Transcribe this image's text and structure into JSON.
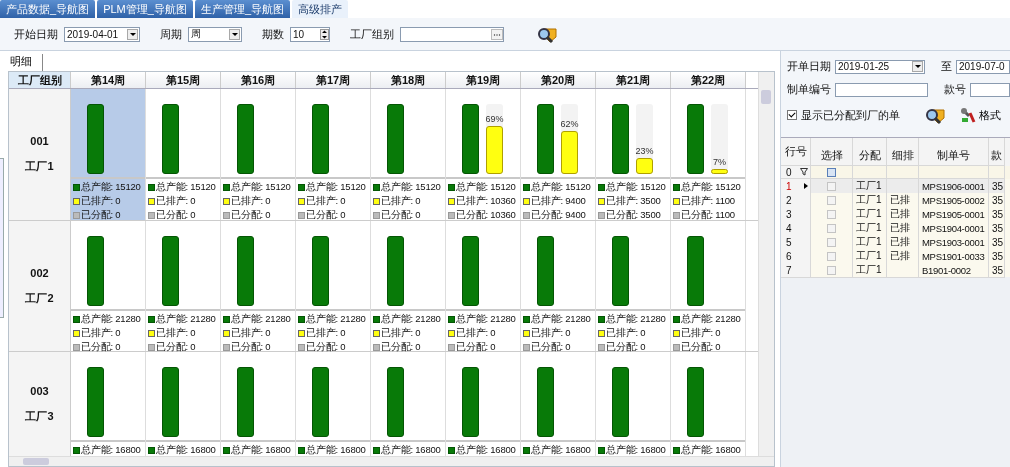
{
  "tabs": [
    {
      "label": "产品数据_导航图",
      "selected": false
    },
    {
      "label": "PLM管理_导航图",
      "selected": false
    },
    {
      "label": "生产管理_导航图",
      "selected": false
    },
    {
      "label": "高级排产",
      "selected": true
    }
  ],
  "filters": {
    "start_date": {
      "label": "开始日期",
      "value": "2019-04-01"
    },
    "period": {
      "label": "周期",
      "value": "周"
    },
    "count": {
      "label": "期数",
      "value": "10"
    },
    "factory_group": {
      "label": "工厂组别"
    }
  },
  "detail_tab": {
    "label": "明细",
    "selected": true
  },
  "grid": {
    "corner_header": "工厂组别",
    "columns": [
      "第14周",
      "第15周",
      "第16周",
      "第17周",
      "第18周",
      "第19周",
      "第20周",
      "第21周",
      "第22周"
    ],
    "rows": [
      {
        "code": "001",
        "name": "工厂1",
        "cells": [
          {
            "selected": true,
            "legend": [
              {
                "kind": "total",
                "text": "总产能: 15120"
              },
              {
                "kind": "scheduled",
                "text": "已排产: 0"
              },
              {
                "kind": "allocated",
                "text": "已分配: 0"
              }
            ]
          },
          {
            "selected": false,
            "legend": [
              {
                "kind": "total",
                "text": "总产能: 15120"
              },
              {
                "kind": "scheduled",
                "text": "已排产: 0"
              },
              {
                "kind": "allocated",
                "text": "已分配: 0"
              }
            ]
          },
          {
            "selected": false,
            "legend": [
              {
                "kind": "total",
                "text": "总产能: 15120"
              },
              {
                "kind": "scheduled",
                "text": "已排产: 0"
              },
              {
                "kind": "allocated",
                "text": "已分配: 0"
              }
            ]
          },
          {
            "selected": false,
            "legend": [
              {
                "kind": "total",
                "text": "总产能: 15120"
              },
              {
                "kind": "scheduled",
                "text": "已排产: 0"
              },
              {
                "kind": "allocated",
                "text": "已分配: 0"
              }
            ]
          },
          {
            "selected": false,
            "legend": [
              {
                "kind": "total",
                "text": "总产能: 15120"
              },
              {
                "kind": "scheduled",
                "text": "已排产: 0"
              },
              {
                "kind": "allocated",
                "text": "已分配: 0"
              }
            ]
          },
          {
            "selected": false,
            "level": 0.69,
            "percent": "69%",
            "legend": [
              {
                "kind": "total",
                "text": "总产能: 15120"
              },
              {
                "kind": "scheduled",
                "text": "已排产: 10360"
              },
              {
                "kind": "allocated",
                "text": "已分配: 10360"
              }
            ]
          },
          {
            "selected": false,
            "level": 0.62,
            "percent": "62%",
            "legend": [
              {
                "kind": "total",
                "text": "总产能: 15120"
              },
              {
                "kind": "scheduled",
                "text": "已排产: 9400"
              },
              {
                "kind": "allocated",
                "text": "已分配: 9400"
              }
            ]
          },
          {
            "selected": false,
            "level": 0.23,
            "percent": "23%",
            "legend": [
              {
                "kind": "total",
                "text": "总产能: 15120"
              },
              {
                "kind": "scheduled",
                "text": "已排产: 3500"
              },
              {
                "kind": "allocated",
                "text": "已分配: 3500"
              }
            ]
          },
          {
            "selected": false,
            "level": 0.07,
            "percent": "7%",
            "legend": [
              {
                "kind": "total",
                "text": "总产能: 15120"
              },
              {
                "kind": "scheduled",
                "text": "已排产: 1100"
              },
              {
                "kind": "allocated",
                "text": "已分配: 1100"
              }
            ]
          }
        ]
      },
      {
        "code": "002",
        "name": "工厂2",
        "cells": [
          {
            "selected": false,
            "legend": [
              {
                "kind": "total",
                "text": "总产能: 21280"
              },
              {
                "kind": "scheduled",
                "text": "已排产: 0"
              },
              {
                "kind": "allocated",
                "text": "已分配: 0"
              }
            ]
          },
          {
            "selected": false,
            "legend": [
              {
                "kind": "total",
                "text": "总产能: 21280"
              },
              {
                "kind": "scheduled",
                "text": "已排产: 0"
              },
              {
                "kind": "allocated",
                "text": "已分配: 0"
              }
            ]
          },
          {
            "selected": false,
            "legend": [
              {
                "kind": "total",
                "text": "总产能: 21280"
              },
              {
                "kind": "scheduled",
                "text": "已排产: 0"
              },
              {
                "kind": "allocated",
                "text": "已分配: 0"
              }
            ]
          },
          {
            "selected": false,
            "legend": [
              {
                "kind": "total",
                "text": "总产能: 21280"
              },
              {
                "kind": "scheduled",
                "text": "已排产: 0"
              },
              {
                "kind": "allocated",
                "text": "已分配: 0"
              }
            ]
          },
          {
            "selected": false,
            "legend": [
              {
                "kind": "total",
                "text": "总产能: 21280"
              },
              {
                "kind": "scheduled",
                "text": "已排产: 0"
              },
              {
                "kind": "allocated",
                "text": "已分配: 0"
              }
            ]
          },
          {
            "selected": false,
            "legend": [
              {
                "kind": "total",
                "text": "总产能: 21280"
              },
              {
                "kind": "scheduled",
                "text": "已排产: 0"
              },
              {
                "kind": "allocated",
                "text": "已分配: 0"
              }
            ]
          },
          {
            "selected": false,
            "legend": [
              {
                "kind": "total",
                "text": "总产能: 21280"
              },
              {
                "kind": "scheduled",
                "text": "已排产: 0"
              },
              {
                "kind": "allocated",
                "text": "已分配: 0"
              }
            ]
          },
          {
            "selected": false,
            "legend": [
              {
                "kind": "total",
                "text": "总产能: 21280"
              },
              {
                "kind": "scheduled",
                "text": "已排产: 0"
              },
              {
                "kind": "allocated",
                "text": "已分配: 0"
              }
            ]
          },
          {
            "selected": false,
            "legend": [
              {
                "kind": "total",
                "text": "总产能: 21280"
              },
              {
                "kind": "scheduled",
                "text": "已排产: 0"
              },
              {
                "kind": "allocated",
                "text": "已分配: 0"
              }
            ]
          }
        ]
      },
      {
        "code": "003",
        "name": "工厂3",
        "cells": [
          {
            "selected": false,
            "legend": [
              {
                "kind": "total",
                "text": "总产能: 16800"
              }
            ]
          },
          {
            "selected": false,
            "legend": [
              {
                "kind": "total",
                "text": "总产能: 16800"
              }
            ]
          },
          {
            "selected": false,
            "legend": [
              {
                "kind": "total",
                "text": "总产能: 16800"
              }
            ]
          },
          {
            "selected": false,
            "legend": [
              {
                "kind": "total",
                "text": "总产能: 16800"
              }
            ]
          },
          {
            "selected": false,
            "legend": [
              {
                "kind": "total",
                "text": "总产能: 16800"
              }
            ]
          },
          {
            "selected": false,
            "legend": [
              {
                "kind": "total",
                "text": "总产能: 16800"
              }
            ]
          },
          {
            "selected": false,
            "legend": [
              {
                "kind": "total",
                "text": "总产能: 16800"
              }
            ]
          },
          {
            "selected": false,
            "legend": [
              {
                "kind": "total",
                "text": "总产能: 16800"
              }
            ]
          },
          {
            "selected": false,
            "legend": [
              {
                "kind": "total",
                "text": "总产能: 16800"
              }
            ]
          }
        ]
      }
    ]
  },
  "orders": {
    "order_date": {
      "label": "开单日期",
      "value": "2019-01-25"
    },
    "to": {
      "label": "至",
      "value": "2019-07-0"
    },
    "order_no": {
      "label": "制单编号"
    },
    "style_no": {
      "label": "款号"
    },
    "show_allocated": {
      "label": "显示已分配到厂的单",
      "checked": true
    },
    "format_button": "格式",
    "table": {
      "row_header": "行号",
      "columns": [
        "选择",
        "分配",
        "细排",
        "制单号",
        "款"
      ],
      "filter_row": {
        "row_number": "0",
        "checked": false
      },
      "rows": [
        {
          "row_number": "1",
          "current": true,
          "checked": false,
          "factory": "工厂1",
          "order_no": "MPS1906-0001",
          "style_no": "35"
        },
        {
          "row_number": "2",
          "current": false,
          "checked": false,
          "factory": "工厂1",
          "scheduled": "已排",
          "order_no": "MPS1905-0002",
          "style_no": "35"
        },
        {
          "row_number": "3",
          "current": false,
          "checked": false,
          "factory": "工厂1",
          "scheduled": "已排",
          "order_no": "MPS1905-0001",
          "style_no": "35"
        },
        {
          "row_number": "4",
          "current": false,
          "checked": false,
          "factory": "工厂1",
          "scheduled": "已排",
          "order_no": "MPS1904-0001",
          "style_no": "35"
        },
        {
          "row_number": "5",
          "current": false,
          "checked": false,
          "factory": "工厂1",
          "scheduled": "已排",
          "order_no": "MPS1903-0001",
          "style_no": "35"
        },
        {
          "row_number": "6",
          "current": false,
          "checked": false,
          "factory": "工厂1",
          "scheduled": "已排",
          "order_no": "MPS1901-0033",
          "style_no": "35"
        },
        {
          "row_number": "7",
          "current": false,
          "checked": false,
          "factory": "工厂1",
          "order_no": "B1901-0002",
          "style_no": "35"
        }
      ]
    }
  }
}
